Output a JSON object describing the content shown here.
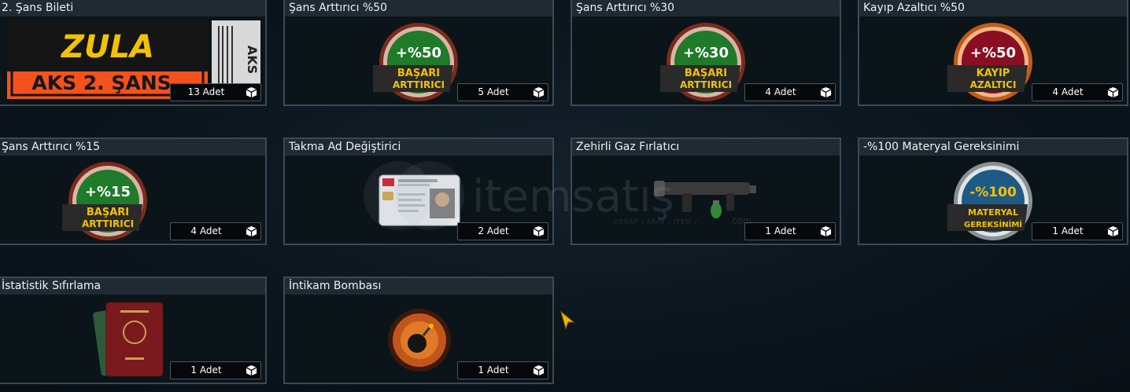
{
  "cards": [
    {
      "title": "2. Şans Bileti",
      "count": "13 Adet",
      "art": "ticket-icon",
      "ticket_top": "ZULA",
      "ticket_bottom": "AKS 2. ŞANS",
      "ticket_side": "AKS"
    },
    {
      "title": "Şans Arttırıcı %50",
      "count": "5 Adet",
      "art": "medal-icon",
      "medal_value": "+%50",
      "medal_line1": "BAŞARI",
      "medal_line2": "ARTTIRICI",
      "medal_color": "#1f7a2a"
    },
    {
      "title": "Şans Arttırıcı %30",
      "count": "4 Adet",
      "art": "medal-icon",
      "medal_value": "+%30",
      "medal_line1": "BAŞARI",
      "medal_line2": "ARTTIRICI",
      "medal_color": "#1f7a2a"
    },
    {
      "title": "Kayıp Azaltıcı %50",
      "count": "4 Adet",
      "art": "medal-icon",
      "medal_value": "+%50",
      "medal_line1": "KAYIP",
      "medal_line2": "AZALTICI",
      "medal_color": "#8a0f22"
    },
    {
      "title": "Şans Arttırıcı %15",
      "count": "4 Adet",
      "art": "medal-icon",
      "medal_value": "+%15",
      "medal_line1": "BAŞARI",
      "medal_line2": "ARTTIRICI",
      "medal_color": "#1f7a2a"
    },
    {
      "title": "Takma Ad Değiştirici",
      "count": "2 Adet",
      "art": "id-card-icon"
    },
    {
      "title": "Zehirli Gaz Fırlatıcı",
      "count": "1 Adet",
      "art": "grenade-launcher-icon"
    },
    {
      "title": "-%100 Materyal Gereksinimi",
      "count": "1 Adet",
      "art": "medal-icon",
      "medal_value": "-%100",
      "medal_line1": "MATERYAL",
      "medal_line2": "GEREKSİNİMİ",
      "medal_color": "#1f5a86"
    },
    {
      "title": "İstatistik Sıfırlama",
      "count": "1 Adet",
      "art": "passport-icon"
    },
    {
      "title": "İntikam Bombası",
      "count": "1 Adet",
      "art": "bomb-icon"
    }
  ],
  "watermark": {
    "brand": "itemsatış",
    "tagline": "HESAP / SKIN / ITEM / ...",
    "domain": ".com"
  },
  "colors": {
    "accent": "#f2c200",
    "card_border": "#3a4a56",
    "title_bg": "#1f2a33"
  }
}
